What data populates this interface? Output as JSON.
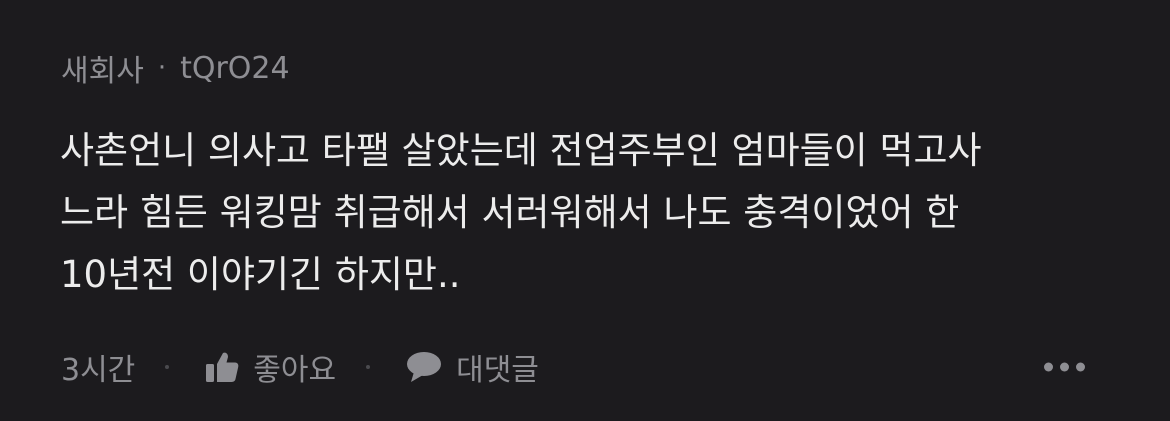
{
  "comment": {
    "author_company": "새회사",
    "separator": "·",
    "author_name": "tQrO24",
    "text": "사촌언니 의사고 타팰 살았는데 전업주부인 엄마들이 먹고사\n느라 힘든 워킹맘 취급해서 서러워해서 나도 충격이었어 한\n10년전 이야기긴 하지만..",
    "time": "3시간",
    "like_label": "좋아요",
    "reply_label": "대댓글"
  },
  "icons": {
    "like": "thumbs-up-icon",
    "reply": "speech-bubble-icon",
    "more": "more-dots-icon"
  },
  "colors": {
    "background": "#1c1b1e",
    "text_primary": "#ececec",
    "text_secondary": "#8e8e93"
  }
}
